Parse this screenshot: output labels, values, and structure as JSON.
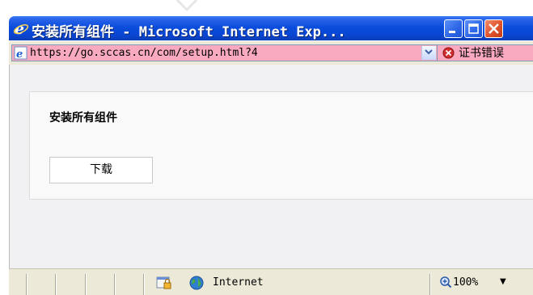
{
  "window": {
    "title": "安装所有组件 - Microsoft Internet Exp...",
    "title_bar_color": "#0b4ddc"
  },
  "address_bar": {
    "url": "https://go.sccas.cn/com/setup.html?4",
    "field_background": "#f9a9c0",
    "cert_error_label": "证书错误"
  },
  "page": {
    "heading": "安装所有组件",
    "download_button_label": "下载"
  },
  "status_bar": {
    "zone": "Internet",
    "zoom": "100%"
  }
}
